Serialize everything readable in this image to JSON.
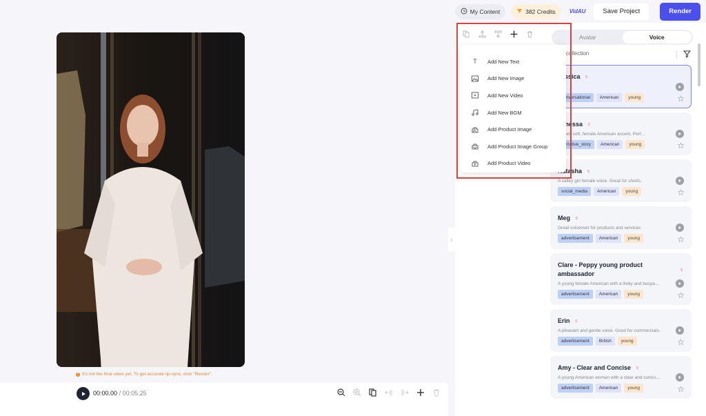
{
  "topbar": {
    "my_content": "My Content",
    "credits": "382 Credits",
    "brand": "VidAU",
    "save_label": "Save Project",
    "render_label": "Render"
  },
  "preview": {
    "hint": "It's not the final video yet, To get accurate lip-sync, click \"Render\".",
    "current_time": "00:00.00",
    "total_time": "/ 00:05.25"
  },
  "timeline_tools": [
    "zoom-out",
    "zoom-in",
    "duplicate",
    "split-left",
    "split-right",
    "add",
    "delete"
  ],
  "element_toolbar": [
    "copy",
    "move-up",
    "move-down",
    "add",
    "delete"
  ],
  "add_menu": {
    "items": [
      {
        "label": "Add New Text",
        "icon": "text-icon"
      },
      {
        "label": "Add New Image",
        "icon": "image-icon"
      },
      {
        "label": "Add New Video",
        "icon": "video-icon"
      },
      {
        "label": "Add New BGM",
        "icon": "music-icon"
      },
      {
        "label": "Add Product Image",
        "icon": "product-image-icon"
      },
      {
        "label": "Add Product Image Group",
        "icon": "product-image-group-icon"
      },
      {
        "label": "Add Product Video",
        "icon": "product-video-icon"
      }
    ]
  },
  "voice_panel": {
    "tabs": [
      {
        "label": "Avatar",
        "active": false
      },
      {
        "label": "Voice",
        "active": true
      }
    ],
    "collection_label": "My collection",
    "voices": [
      {
        "name": "Jessica",
        "desc": "",
        "tags": [
          "conversational",
          "American",
          "young"
        ],
        "selected": true
      },
      {
        "name": "Vanessa",
        "desc": "Sweet, soft, female American accent. Perf...",
        "tags": [
          "narrative_story",
          "American",
          "young"
        ],
        "selected": false
      },
      {
        "name": "Natasha",
        "desc": "A valley girl female voice. Great for shorts.",
        "tags": [
          "social_media",
          "American",
          "young"
        ],
        "selected": false
      },
      {
        "name": "Meg",
        "desc": "Great voiceover for products and services",
        "tags": [
          "advertisement",
          "American",
          "young"
        ],
        "selected": false
      },
      {
        "name": "Clare - Peppy young product ambassador",
        "desc": "A young female American with a lively and buoya...",
        "tags": [
          "advertisement",
          "American",
          "young"
        ],
        "selected": false
      },
      {
        "name": "Erin",
        "desc": "A pleasant and gentle voice. Good for commercials.",
        "tags": [
          "advertisement",
          "British",
          "young"
        ],
        "selected": false
      },
      {
        "name": "Amy - Clear and Concise",
        "desc": "A young American woman with a clear and concis...",
        "tags": [
          "advertisement",
          "American",
          "young"
        ],
        "selected": false
      }
    ]
  },
  "colors": {
    "accent": "#4b4ff0",
    "highlight_box": "#d9423d",
    "hint": "#e08a2c"
  }
}
